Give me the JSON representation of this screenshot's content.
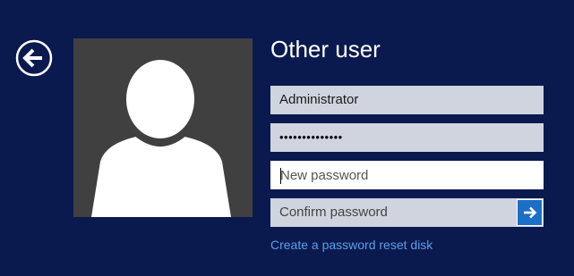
{
  "header": {
    "back_icon": "back-arrow-circle-icon"
  },
  "user": {
    "avatar_icon": "user-silhouette-icon",
    "title": "Other user"
  },
  "form": {
    "username_value": "Administrator",
    "password_value": "••••••••••••••",
    "new_password_placeholder": "New password",
    "confirm_password_placeholder": "Confirm password",
    "submit_icon": "arrow-right-icon",
    "reset_link_label": "Create a password reset disk"
  },
  "colors": {
    "background": "#0a1a4f",
    "avatar_bg": "#404040",
    "field_bg": "#d0d4df",
    "active_field_bg": "#ffffff",
    "submit_button": "#1b6fc6",
    "link": "#5c9ee8"
  }
}
